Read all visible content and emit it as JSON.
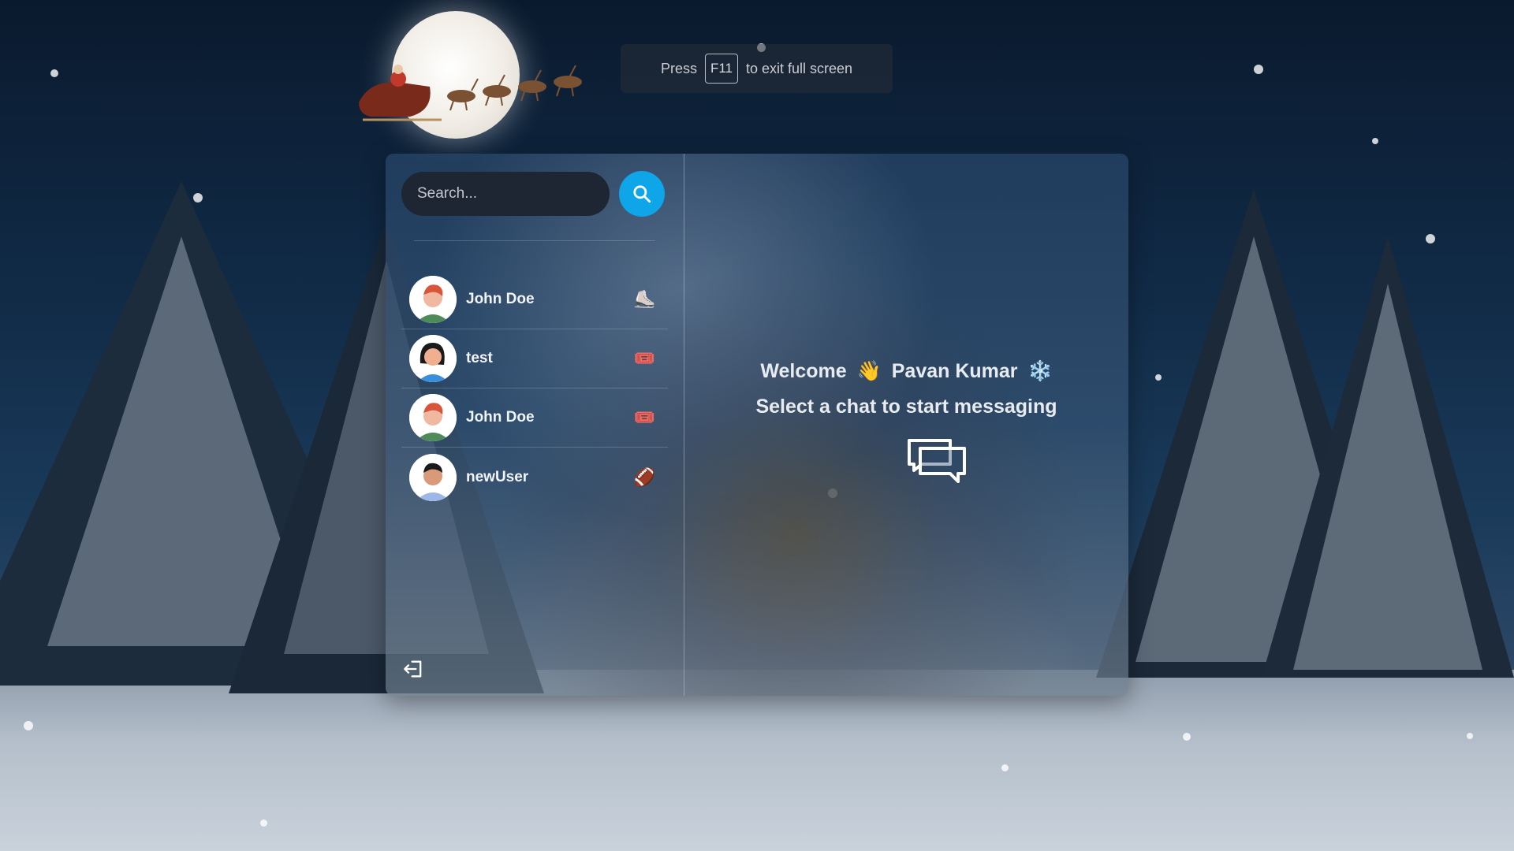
{
  "fullscreen_hint": {
    "press": "Press",
    "key": "F11",
    "rest": "to exit full screen"
  },
  "sidebar": {
    "search_placeholder": "Search...",
    "conversations": [
      {
        "name": "John Doe",
        "emoji": "⛸️",
        "avatar": "male-red-hair"
      },
      {
        "name": "test",
        "emoji": "🎟️",
        "avatar": "female-dark-hair"
      },
      {
        "name": "John Doe",
        "emoji": "🎟️",
        "avatar": "male-red-hair"
      },
      {
        "name": "newUser",
        "emoji": "🏈",
        "avatar": "male-dark-hair"
      }
    ]
  },
  "welcome": {
    "greeting": "Welcome",
    "wave": "👋",
    "username": "Pavan Kumar",
    "snowflake": "❄️",
    "prompt": "Select a chat to start messaging"
  },
  "colors": {
    "accent": "#0ea5e9",
    "search_bg": "#1d2632"
  }
}
